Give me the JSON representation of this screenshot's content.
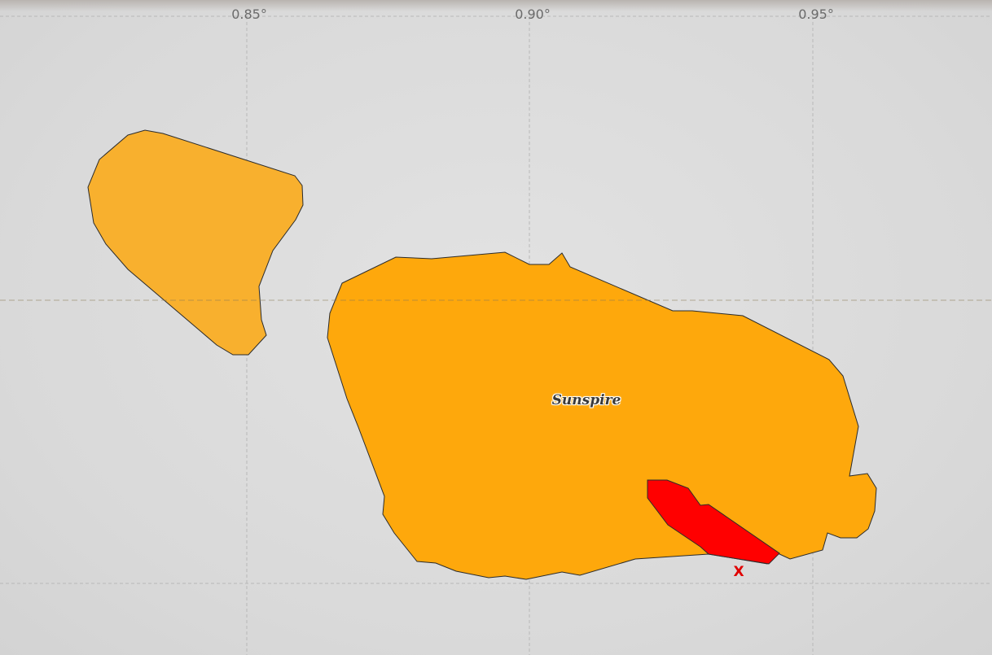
{
  "map": {
    "longitude_ticks": [
      "0.85°",
      "0.90°",
      "0.95°"
    ],
    "colors": {
      "background": "#dcdcdc",
      "region_fill": "#fea80c",
      "island_fill": "#f8b02e",
      "highlight_fill": "#ff0000",
      "outline": "#2b2b2b",
      "grid": "#b8b8b8"
    },
    "regions": [
      {
        "id": "western-island",
        "label": ""
      },
      {
        "id": "main-island",
        "label": "Sunspire"
      },
      {
        "id": "highlight-zone",
        "label": ""
      }
    ],
    "marker": {
      "text": "X",
      "color": "#e00000"
    }
  }
}
